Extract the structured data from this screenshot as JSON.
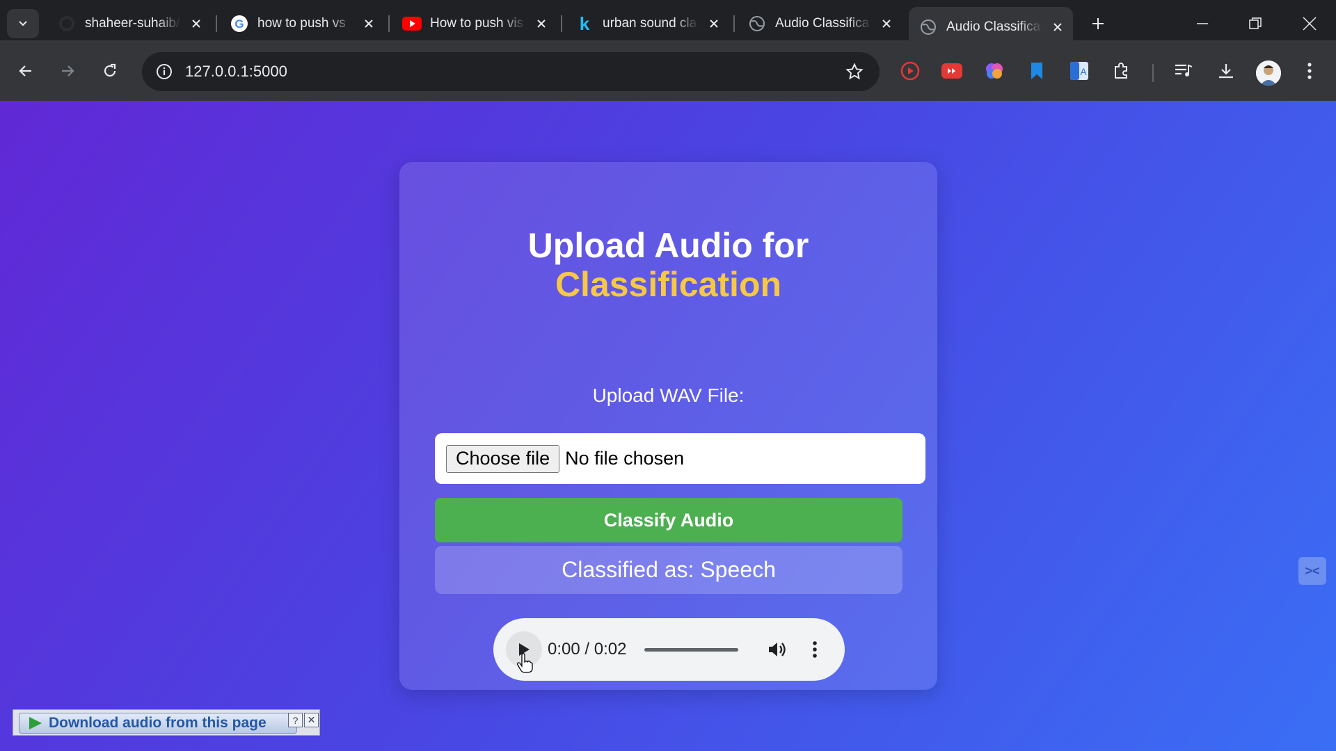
{
  "tabs": [
    {
      "title": "shaheer-suhaib/",
      "favicon": "github-icon",
      "active": false
    },
    {
      "title": "how to push vs",
      "favicon": "google-icon",
      "active": false
    },
    {
      "title": "How to push vis",
      "favicon": "youtube-icon",
      "active": false
    },
    {
      "title": "urban sound cla",
      "favicon": "kaggle-icon",
      "active": false
    },
    {
      "title": "Audio Classifica",
      "favicon": "globe-icon",
      "active": false
    },
    {
      "title": "Audio Classifica",
      "favicon": "globe-icon",
      "active": true
    }
  ],
  "address_bar": {
    "url": "127.0.0.1:5000"
  },
  "page": {
    "heading_line1": "Upload Audio for",
    "heading_line2": "Classification",
    "upload_label": "Upload WAV File:",
    "choose_file_label": "Choose file",
    "no_file_text": "No file chosen",
    "classify_button": "Classify Audio",
    "result_text": "Classified as: Speech",
    "player": {
      "time": "0:00 / 0:02",
      "progress_fraction": 0
    }
  },
  "download_bar": {
    "label": "Download audio from this page",
    "help": "?",
    "close": "✕"
  },
  "colors": {
    "accent_yellow": "#f7c844",
    "classify_green": "#4caf50",
    "bg_start": "#6128d6",
    "bg_end": "#3a6ef5"
  }
}
